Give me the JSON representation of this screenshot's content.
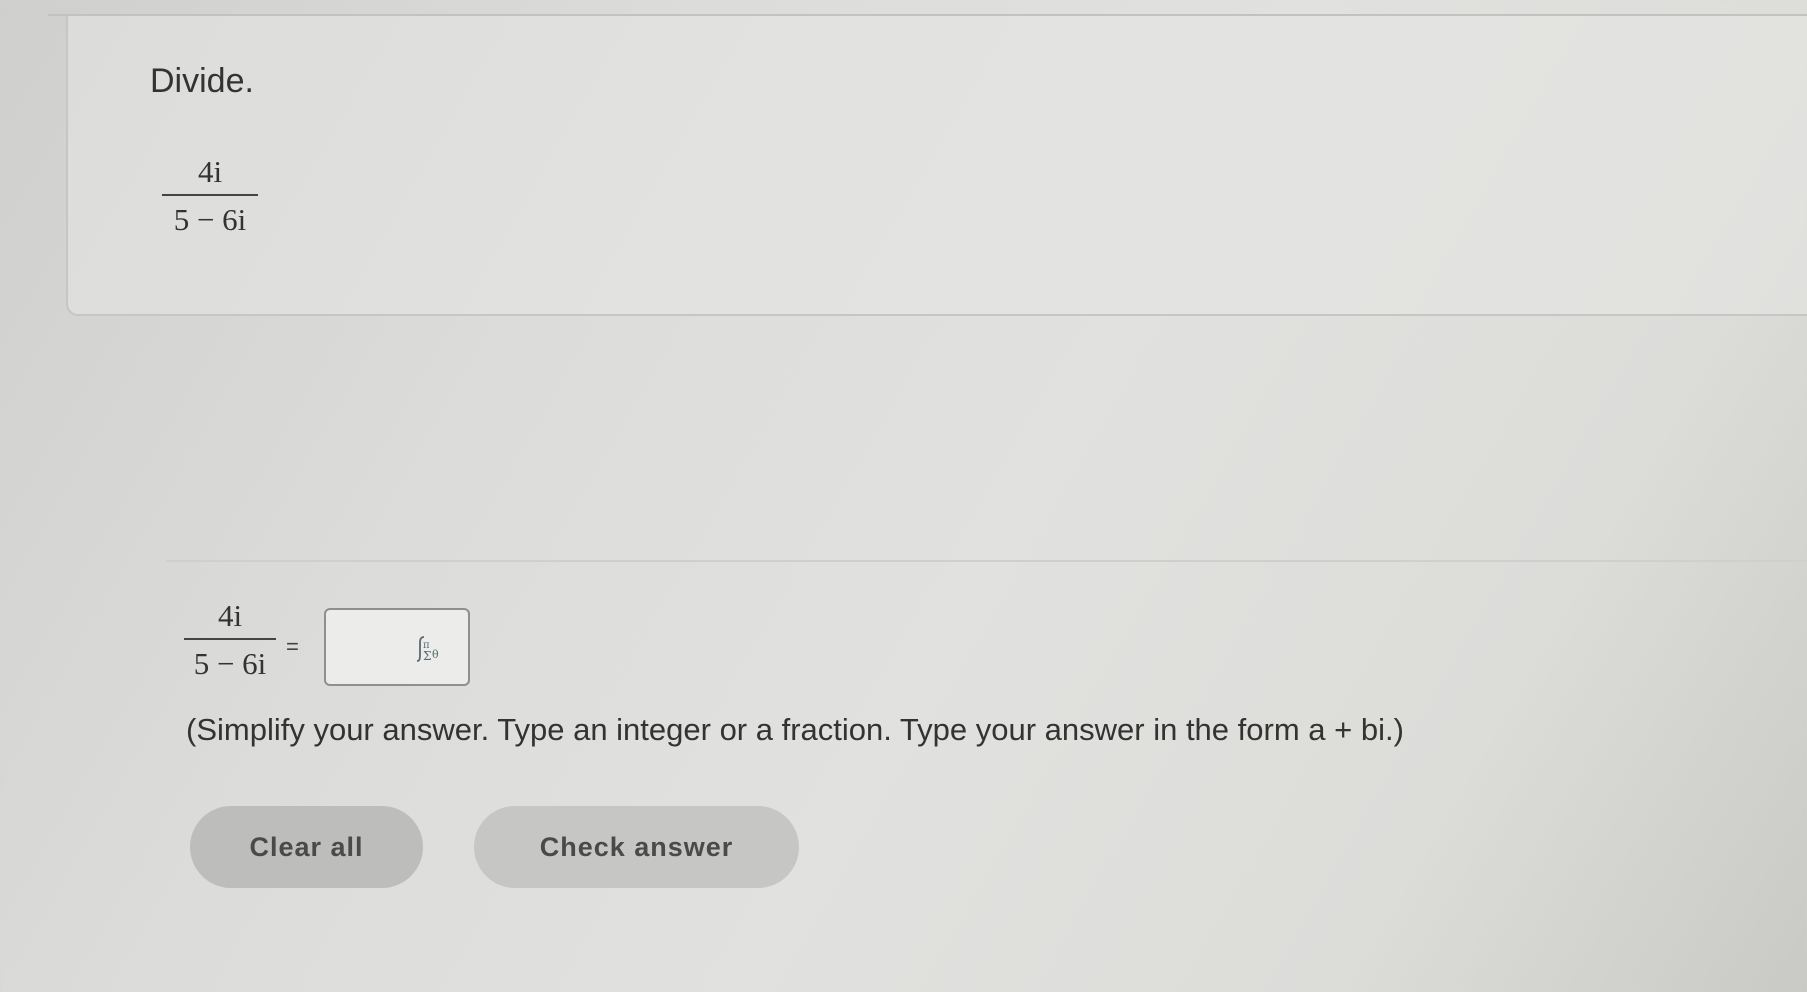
{
  "question": {
    "instruction": "Divide.",
    "expression": {
      "numerator": "4i",
      "denominator": "5 − 6i"
    }
  },
  "answer": {
    "lhs_numerator": "4i",
    "lhs_denominator": "5 − 6i",
    "equals": "=",
    "input_value": "",
    "palette_icon": "math-palette-icon",
    "hint": "(Simplify your answer. Type an integer or a fraction. Type your answer in the form a + bi.)"
  },
  "buttons": {
    "clear_all": "Clear all",
    "check_answer": "Check answer"
  }
}
